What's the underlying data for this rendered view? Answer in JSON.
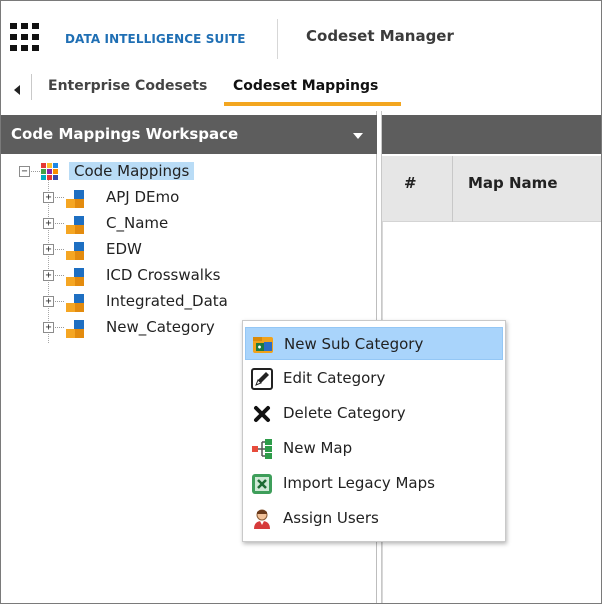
{
  "header": {
    "suite_name": "DATA INTELLIGENCE SUITE",
    "module_name": "Codeset Manager",
    "app_icon": "app-grid-icon"
  },
  "tabs": [
    {
      "label": "Enterprise Codesets",
      "active": false
    },
    {
      "label": "Codeset Mappings",
      "active": true
    }
  ],
  "workspace": {
    "title": "Code Mappings Workspace",
    "root": {
      "label": "Code Mappings",
      "icon": "colorful-grid-icon",
      "selected": true
    },
    "categories": [
      {
        "label": "APJ DEmo",
        "icon": "category-icon"
      },
      {
        "label": "C_Name",
        "icon": "category-icon"
      },
      {
        "label": "EDW",
        "icon": "category-icon"
      },
      {
        "label": "ICD Crosswalks",
        "icon": "category-icon"
      },
      {
        "label": "Integrated_Data",
        "icon": "category-icon"
      },
      {
        "label": "New_Category",
        "icon": "category-icon"
      }
    ]
  },
  "grid": {
    "columns": [
      "#",
      "Map Name"
    ]
  },
  "context_menu": {
    "items": [
      {
        "label": "New Sub Category",
        "icon": "new-subcategory-icon",
        "highlighted": true
      },
      {
        "label": "Edit Category",
        "icon": "edit-pencil-icon"
      },
      {
        "label": "Delete Category",
        "icon": "delete-x-icon"
      },
      {
        "label": "New Map",
        "icon": "new-map-icon"
      },
      {
        "label": "Import Legacy Maps",
        "icon": "import-excel-icon"
      },
      {
        "label": "Assign Users",
        "icon": "assign-user-icon"
      }
    ]
  },
  "colors": {
    "brand": "#1f6fb4",
    "accent": "#f3a620",
    "selection": "#b9dcf6",
    "menu_highlight": "#a9d4fb",
    "panel_header": "#5d5d5d"
  }
}
